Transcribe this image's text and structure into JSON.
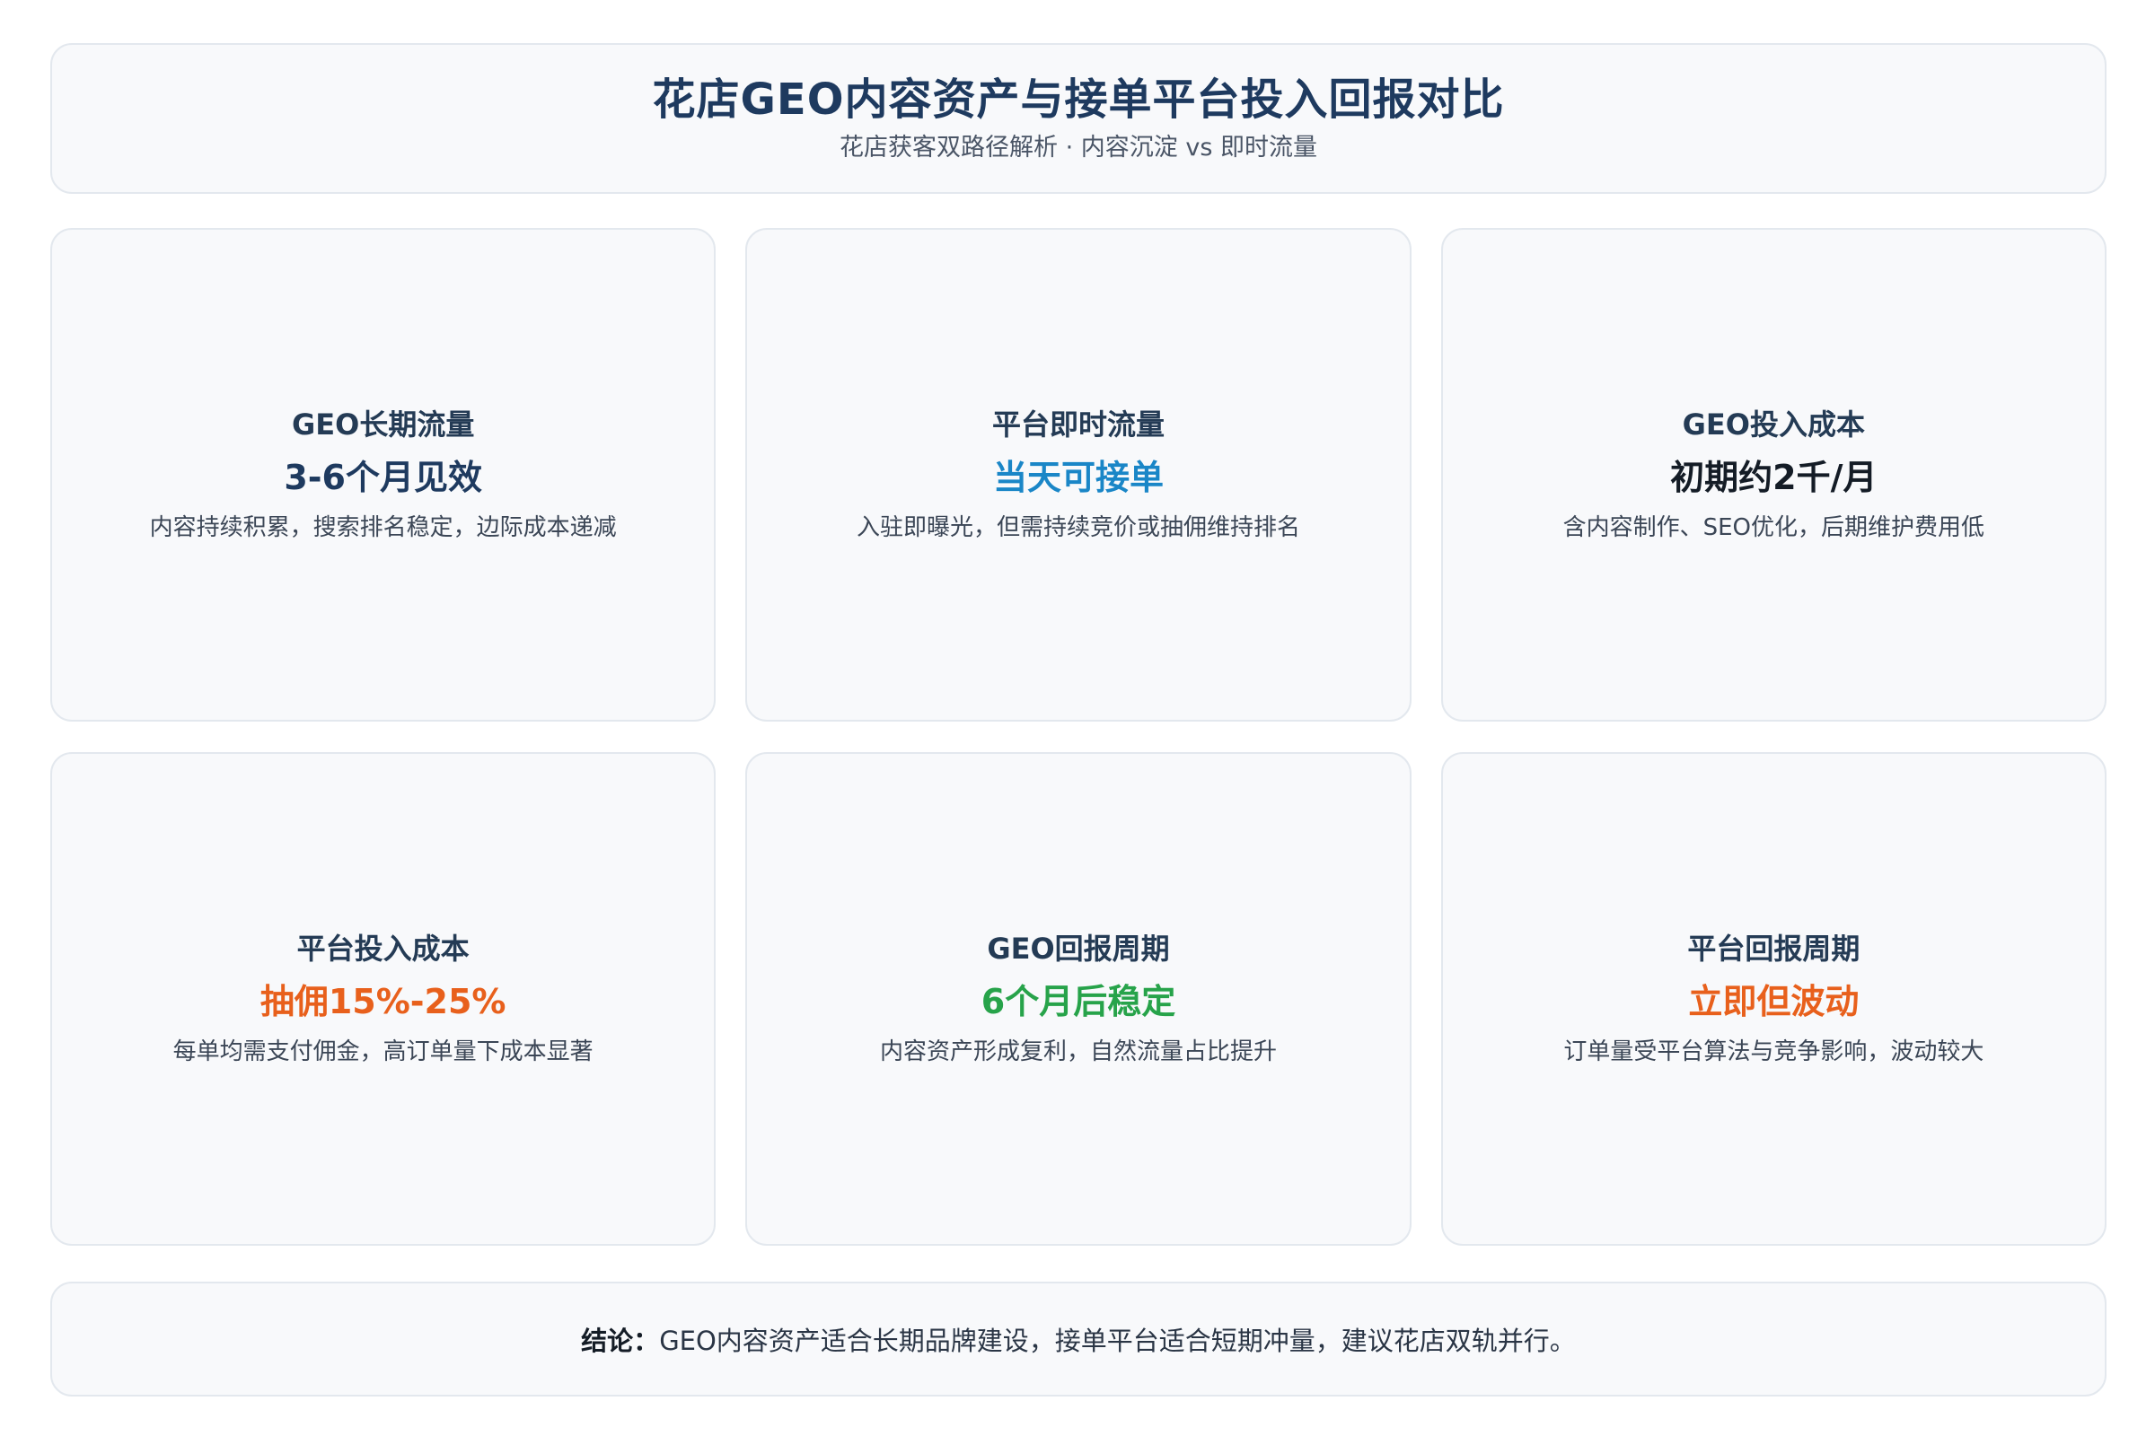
{
  "header": {
    "title": "花店GEO内容资产与接单平台投入回报对比",
    "subtitle": "花店获客双路径解析 · 内容沉淀 vs 即时流量"
  },
  "cards": [
    {
      "label": "GEO长期流量",
      "value": "3-6个月见效",
      "value_color": "#1e3a5f",
      "description": "内容持续积累，搜索排名稳定，边际成本递减"
    },
    {
      "label": "平台即时流量",
      "value": "当天可接单",
      "value_color": "#1a86c7",
      "description": "入驻即曝光，但需持续竞价或抽佣维持排名"
    },
    {
      "label": "GEO投入成本",
      "value": "初期约2千/月",
      "value_color": "#141c26",
      "description": "含内容制作、SEO优化，后期维护费用低"
    },
    {
      "label": "平台投入成本",
      "value": "抽佣15%-25%",
      "value_color": "#e8601c",
      "description": "每单均需支付佣金，高订单量下成本显著"
    },
    {
      "label": "GEO回报周期",
      "value": "6个月后稳定",
      "value_color": "#27a34a",
      "description": "内容资产形成复利，自然流量占比提升"
    },
    {
      "label": "平台回报周期",
      "value": "立即但波动",
      "value_color": "#e8601c",
      "description": "订单量受平台算法与竞争影响，波动较大"
    }
  ],
  "conclusion": {
    "label": "结论：",
    "text": "GEO内容资产适合长期品牌建设，接单平台适合短期冲量，建议花店双轨并行。"
  }
}
